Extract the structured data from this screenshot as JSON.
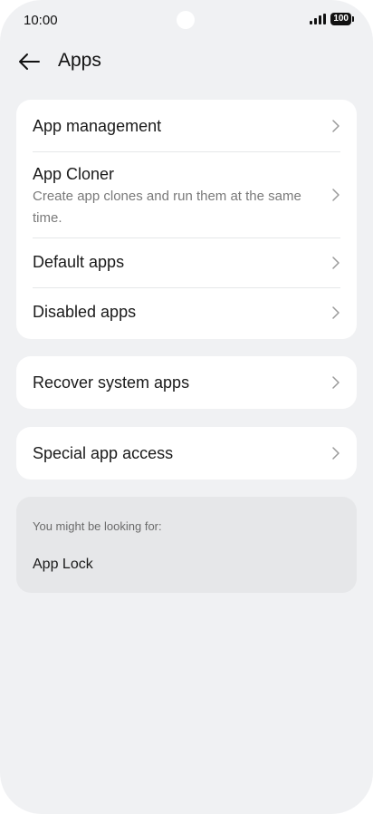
{
  "status_bar": {
    "time": "10:00",
    "battery": "100",
    "signal_icon": "signal-bars-icon"
  },
  "header": {
    "title": "Apps",
    "back_icon": "arrow-left-icon"
  },
  "group1": {
    "items": [
      {
        "title": "App management"
      },
      {
        "title": "App Cloner",
        "subtitle": "Create app clones and run them at the same time."
      },
      {
        "title": "Default apps"
      },
      {
        "title": "Disabled apps"
      }
    ]
  },
  "group2": {
    "items": [
      {
        "title": "Recover system apps"
      }
    ]
  },
  "group3": {
    "items": [
      {
        "title": "Special app access"
      }
    ]
  },
  "suggestions": {
    "label": "You might be looking for:",
    "items": [
      {
        "title": "App Lock"
      }
    ]
  },
  "colors": {
    "background": "#f0f1f3",
    "card": "#ffffff",
    "suggestion_card": "#e6e7e9",
    "subtitle": "#7a7a7a",
    "chevron": "#9a9a9a"
  }
}
